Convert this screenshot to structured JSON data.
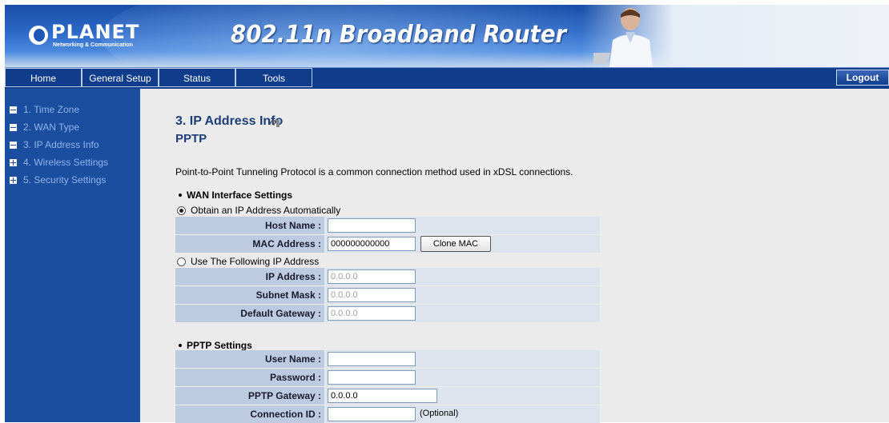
{
  "banner": {
    "logo_brand": "PLANET",
    "logo_tagline": "Networking & Communication",
    "title": "802.11n Broadband Router"
  },
  "nav": {
    "items": [
      "Home",
      "General Setup",
      "Status",
      "Tools"
    ],
    "logout": "Logout"
  },
  "sidebar": {
    "items": [
      {
        "label": "1. Time Zone",
        "icon": "minus-box-icon"
      },
      {
        "label": "2. WAN Type",
        "icon": "minus-box-icon"
      },
      {
        "label": "3. IP Address Info",
        "icon": "minus-box-icon"
      },
      {
        "label": "4. Wireless Settings",
        "icon": "plus-box-icon"
      },
      {
        "label": "5. Security Settings",
        "icon": "plus-box-icon"
      }
    ]
  },
  "main": {
    "title": "3. IP Address Info",
    "subtitle": "PPTP",
    "description": "Point-to-Point Tunneling Protocol is a common connection method used in xDSL connections.",
    "wan_section": "WAN Interface Settings",
    "radio_auto": "Obtain an IP Address Automatically",
    "radio_auto_selected": true,
    "host_name_label": "Host Name :",
    "host_name_value": "",
    "mac_label": "MAC Address :",
    "mac_value": "000000000000",
    "clone_mac": "Clone MAC",
    "radio_fixed": "Use The Following IP Address",
    "ip_label": "IP Address :",
    "ip_value": "0.0.0.0",
    "subnet_label": "Subnet Mask :",
    "subnet_value": "0.0.0.0",
    "gateway_label": "Default Gateway :",
    "gateway_value": "0.0.0.0",
    "pptp_section": "PPTP Settings",
    "user_label": "User Name :",
    "user_value": "",
    "password_label": "Password :",
    "password_value": "",
    "pptp_gateway_label": "PPTP Gateway :",
    "pptp_gateway_value": "0.0.0.0",
    "conn_id_label": "Connection ID :",
    "conn_id_value": "",
    "optional": "(Optional)"
  },
  "colors": {
    "nav_bg": "#0f3d8c",
    "sidebar_bg": "#1b4e9f",
    "sidebar_text": "#8fb3ec",
    "label_cell": "#bccbe0",
    "title_color": "#1d3e78"
  }
}
